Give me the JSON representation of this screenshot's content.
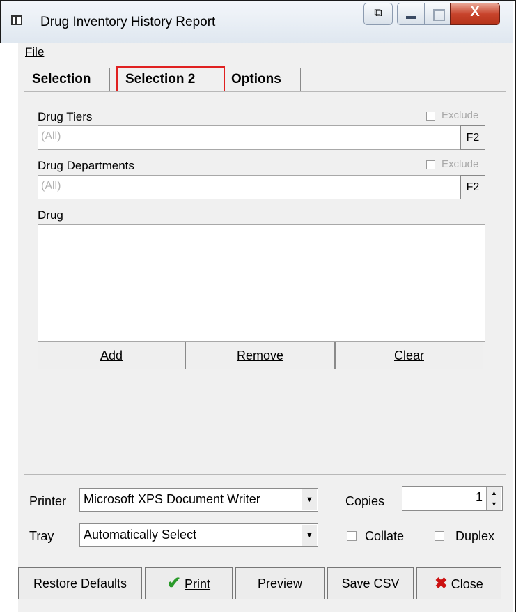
{
  "window": {
    "title": "Drug Inventory History Report"
  },
  "menu": {
    "file": "File"
  },
  "tabs": [
    {
      "label": "Selection"
    },
    {
      "label": "Selection 2",
      "selected": true
    },
    {
      "label": "Options"
    }
  ],
  "drug_tiers": {
    "label": "Drug Tiers",
    "value": "(All)",
    "lookup": "F2",
    "exclude_label": "Exclude",
    "exclude_checked": false
  },
  "drug_departments": {
    "label": "Drug Departments",
    "value": "(All)",
    "lookup": "F2",
    "exclude_label": "Exclude",
    "exclude_checked": false
  },
  "drug": {
    "label": "Drug",
    "items": [],
    "add": "Add",
    "remove": "Remove",
    "clear": "Clear"
  },
  "printer": {
    "label": "Printer",
    "value": "Microsoft XPS Document Writer"
  },
  "tray": {
    "label": "Tray",
    "value": "Automatically Select"
  },
  "copies": {
    "label": "Copies",
    "value": "1"
  },
  "collate": {
    "label": "Collate",
    "checked": false
  },
  "duplex": {
    "label": "Duplex",
    "checked": false
  },
  "buttons": {
    "restore_defaults": "Restore Defaults",
    "print": "Print",
    "preview": "Preview",
    "save_csv": "Save CSV",
    "close": "Close"
  },
  "colors": {
    "highlight": "#e02020",
    "print_check": "#2a9a2a",
    "close_x": "#cc1111"
  }
}
